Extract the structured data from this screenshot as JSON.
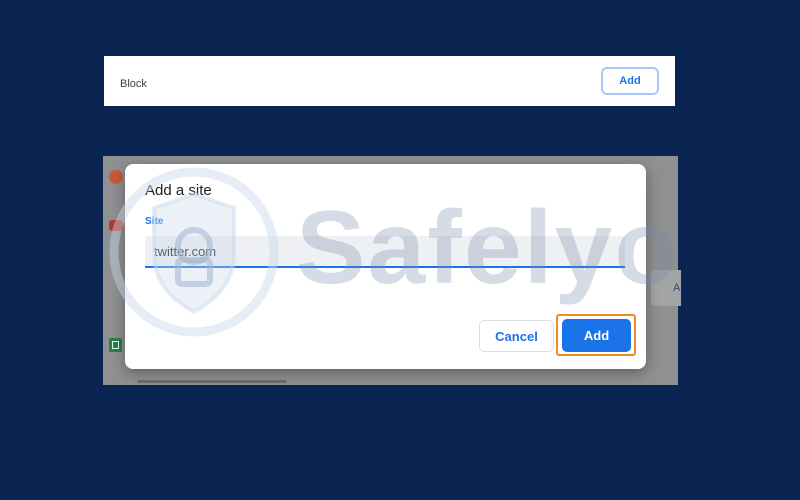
{
  "block_section": {
    "label": "Block",
    "add_button_label": "Add"
  },
  "dialog": {
    "title": "Add a site",
    "site_field": {
      "label": "Site",
      "value": "twitter.com"
    },
    "cancel_label": "Cancel",
    "add_label": "Add"
  },
  "background_panel": {
    "partial_letter": "A",
    "icons": [
      "reddit-icon",
      "youtube-icon",
      "google-sheets-icon"
    ]
  },
  "watermark": {
    "text": "Safelyo"
  },
  "colors": {
    "page_background": "#0b2552",
    "accent": "#1a73e8",
    "highlight": "#f08a24"
  }
}
